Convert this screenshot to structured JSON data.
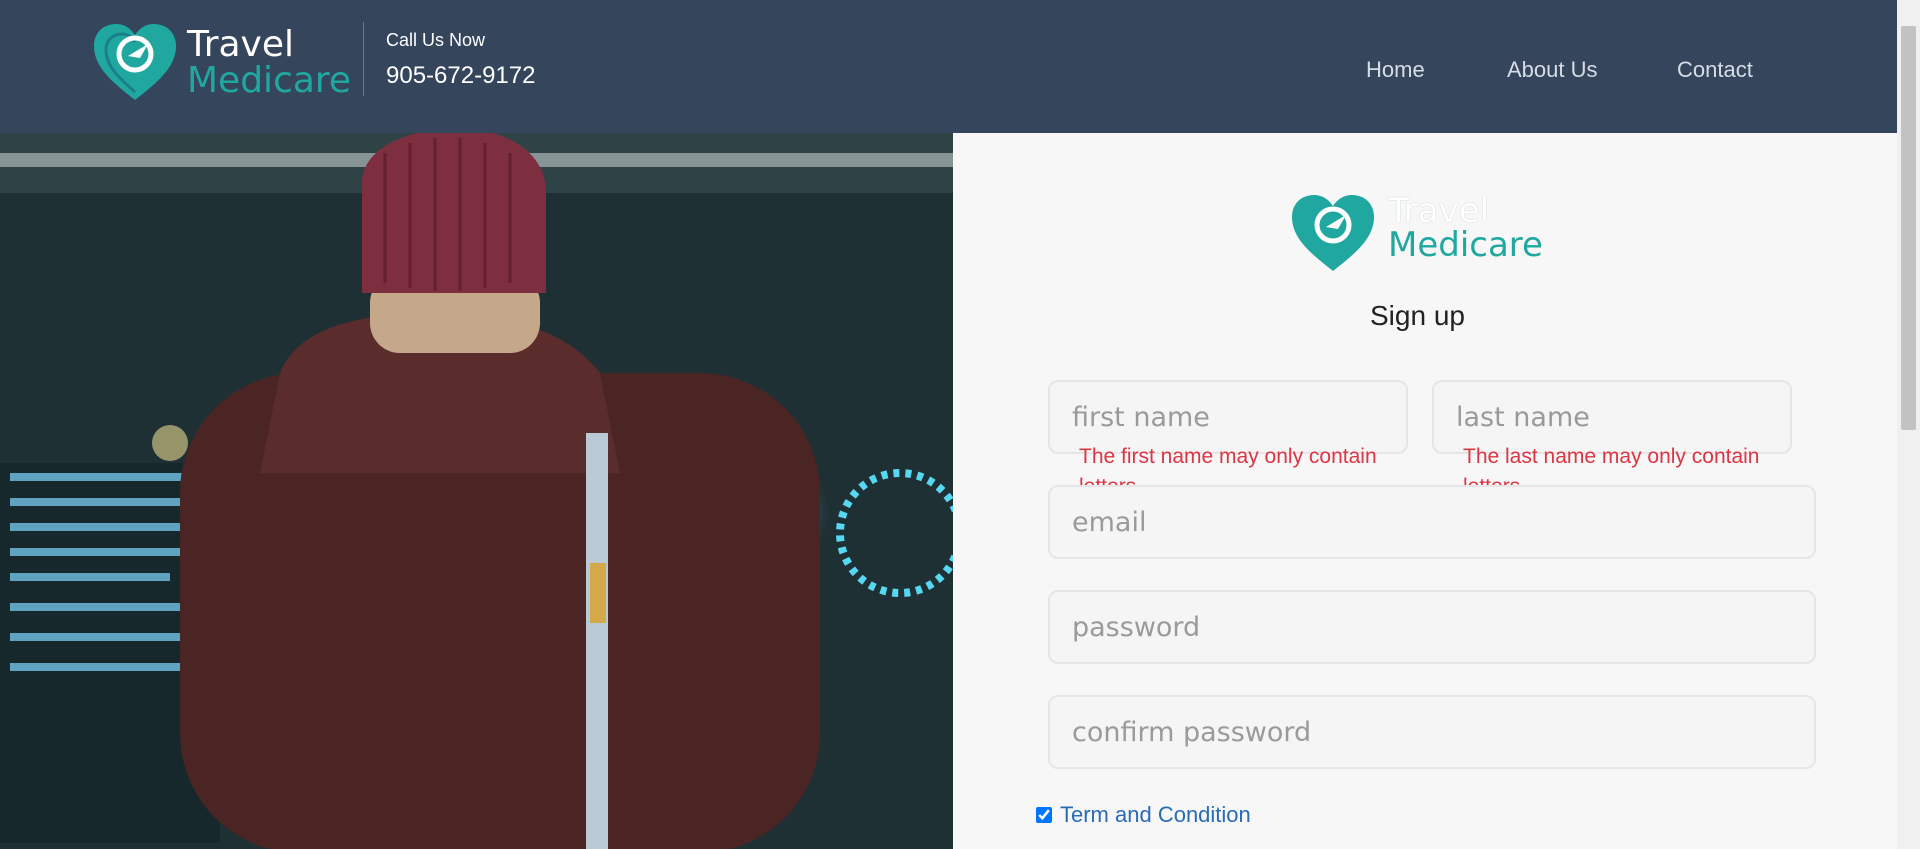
{
  "brand": {
    "line1": "Travel",
    "line2": "Medicare"
  },
  "contact": {
    "label": "Call Us Now",
    "phone": "905-672-9172"
  },
  "nav": {
    "home": "Home",
    "about": "About Us",
    "contact": "Contact"
  },
  "form": {
    "title": "Sign up",
    "first_name_placeholder": "first name",
    "last_name_placeholder": "last name",
    "email_placeholder": "email",
    "password_placeholder": "password",
    "confirm_password_placeholder": "confirm password",
    "first_name_error": "The first name may only contain letters.",
    "last_name_error": "The last name may only contain letters.",
    "terms_label": "Term and Condition",
    "terms_checked": true
  },
  "colors": {
    "header_bg": "#34455c",
    "brand_teal": "#20a8a0",
    "error": "#dc3545",
    "link": "#2a6bb8"
  }
}
